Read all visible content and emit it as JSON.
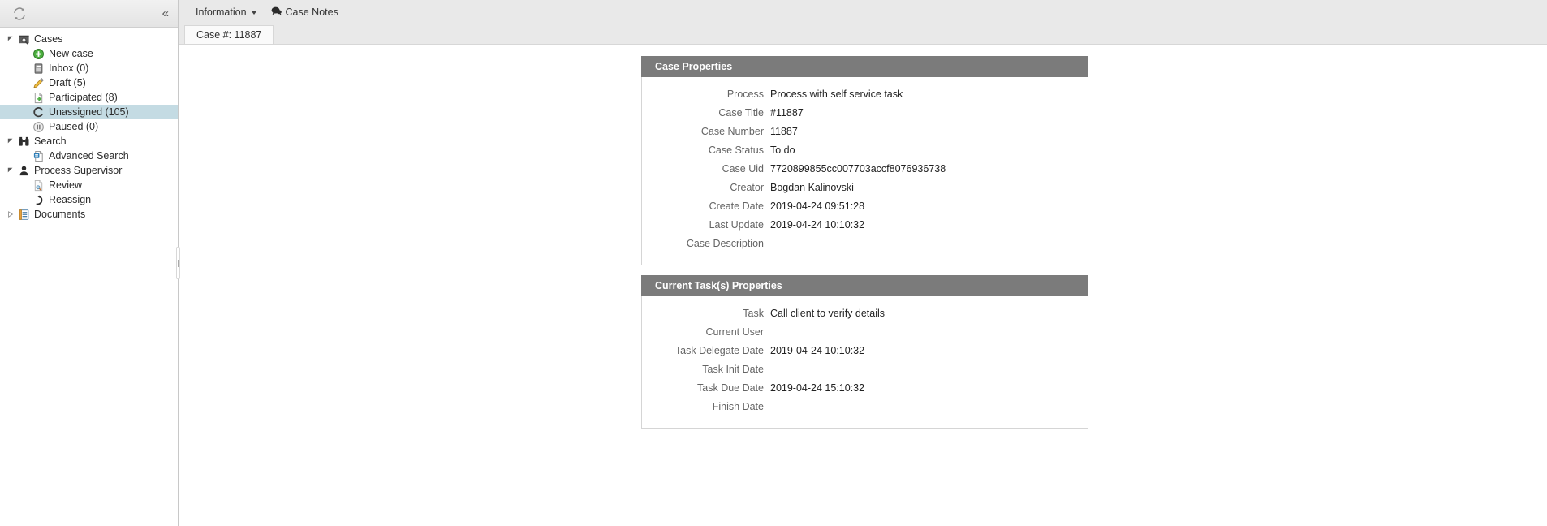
{
  "sidebar": {
    "header": {
      "refresh_icon": "refresh-icon",
      "collapse_label": "«"
    },
    "items": [
      {
        "label": "Cases",
        "icon": "cases-folder-icon",
        "indent": 0,
        "twisty": "expanded",
        "selected": false
      },
      {
        "label": "New case",
        "icon": "plus-circle-icon",
        "indent": 1,
        "twisty": "none",
        "selected": false
      },
      {
        "label": "Inbox (0)",
        "icon": "inbox-icon",
        "indent": 1,
        "twisty": "none",
        "selected": false
      },
      {
        "label": "Draft (5)",
        "icon": "pencil-icon",
        "indent": 1,
        "twisty": "none",
        "selected": false
      },
      {
        "label": "Participated (8)",
        "icon": "page-arrow-icon",
        "indent": 1,
        "twisty": "none",
        "selected": false
      },
      {
        "label": "Unassigned (105)",
        "icon": "refresh-arc-icon",
        "indent": 1,
        "twisty": "none",
        "selected": true
      },
      {
        "label": "Paused (0)",
        "icon": "pause-circle-icon",
        "indent": 1,
        "twisty": "none",
        "selected": false
      },
      {
        "label": "Search",
        "icon": "binoculars-icon",
        "indent": 0,
        "twisty": "expanded",
        "selected": false
      },
      {
        "label": "Advanced Search",
        "icon": "advanced-search-icon",
        "indent": 1,
        "twisty": "none",
        "selected": false
      },
      {
        "label": "Process Supervisor",
        "icon": "person-icon",
        "indent": 0,
        "twisty": "expanded",
        "selected": false
      },
      {
        "label": "Review",
        "icon": "review-page-icon",
        "indent": 1,
        "twisty": "none",
        "selected": false
      },
      {
        "label": "Reassign",
        "icon": "reassign-arrow-icon",
        "indent": 1,
        "twisty": "none",
        "selected": false
      },
      {
        "label": "Documents",
        "icon": "documents-icon",
        "indent": 0,
        "twisty": "collapsed",
        "selected": false
      }
    ],
    "splitter": {
      "name": "sidebar-splitter"
    }
  },
  "menubar": {
    "information_label": "Information",
    "case_notes_label": "Case Notes",
    "case_notes_icon": "comment-bubbles-icon"
  },
  "tabs": [
    {
      "label": "Case #: 11887",
      "active": true
    }
  ],
  "panels": [
    {
      "title": "Case Properties",
      "fields": [
        {
          "label": "Process",
          "value": "Process with self service task"
        },
        {
          "label": "Case Title",
          "value": "#11887"
        },
        {
          "label": "Case Number",
          "value": "11887"
        },
        {
          "label": "Case Status",
          "value": "To do"
        },
        {
          "label": "Case Uid",
          "value": "7720899855cc007703accf8076936738"
        },
        {
          "label": "Creator",
          "value": "Bogdan Kalinovski"
        },
        {
          "label": "Create Date",
          "value": "2019-04-24 09:51:28"
        },
        {
          "label": "Last Update",
          "value": "2019-04-24 10:10:32"
        },
        {
          "label": "Case Description",
          "value": ""
        }
      ]
    },
    {
      "title": "Current Task(s) Properties",
      "fields": [
        {
          "label": "Task",
          "value": "Call client to verify details"
        },
        {
          "label": "Current User",
          "value": ""
        },
        {
          "label": "Task Delegate Date",
          "value": "2019-04-24 10:10:32"
        },
        {
          "label": "Task Init Date",
          "value": ""
        },
        {
          "label": "Task Due Date",
          "value": "2019-04-24 15:10:32"
        },
        {
          "label": "Finish Date",
          "value": ""
        }
      ]
    }
  ],
  "colors": {
    "panel_header_bg": "#7b7b7b",
    "selected_row_bg": "#c4dbe3",
    "toolbar_bg": "#e9e9e9",
    "label_text": "#646464",
    "value_text": "#222222"
  }
}
